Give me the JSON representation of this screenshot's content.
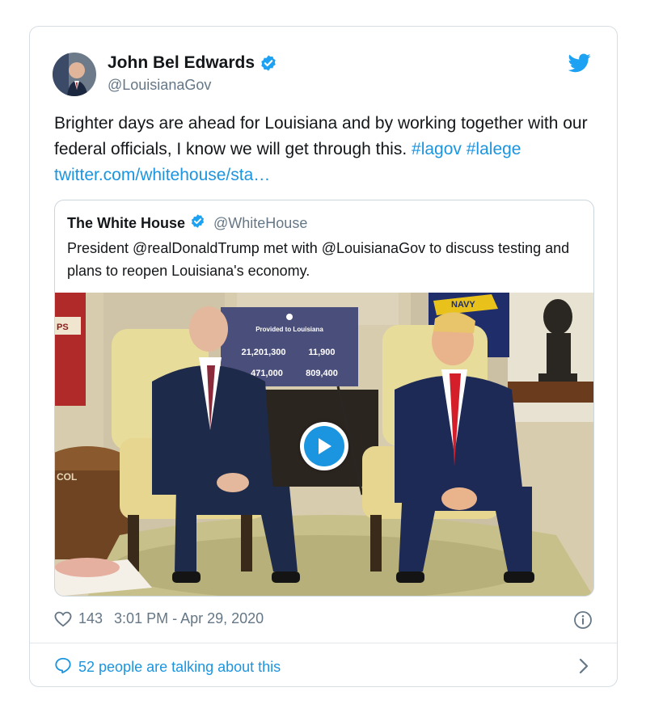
{
  "tweet": {
    "author_name": "John Bel Edwards",
    "author_handle": "@LouisianaGov",
    "text_plain": "Brighter days are ahead for Louisiana and by working together with our federal officials, I know we will get through this.",
    "hashtag_1": "#lagov",
    "hashtag_2": "#lalege",
    "link": "twitter.com/whitehouse/sta…",
    "likes": "143",
    "timestamp": "3:01 PM - Apr 29, 2020",
    "talking": "52 people are talking about this"
  },
  "quote": {
    "author_name": "The White House",
    "author_handle": "@WhiteHouse",
    "text": "President @realDonaldTrump met with @LouisianaGov to discuss testing and plans to reopen Louisiana's economy."
  },
  "media": {
    "sign_title": "Provided to Louisiana",
    "sign_value_1": "21,201,300",
    "sign_value_2": "11,900",
    "sign_value_3": "471,000",
    "sign_value_4": "809,400",
    "flag_text": "NAVY",
    "flag_text_left": "PS",
    "chair_text": "COL"
  },
  "colors": {
    "link": "#1b95e0",
    "verified": "#1da1f2",
    "text": "#14171a",
    "secondary": "#657786"
  },
  "icons": [
    "verified-badge-icon",
    "twitter-bird-icon",
    "play-icon",
    "heart-icon",
    "info-icon",
    "comment-icon",
    "chevron-right-icon"
  ]
}
